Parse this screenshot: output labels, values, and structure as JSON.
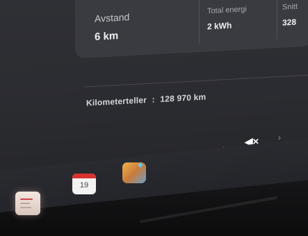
{
  "trip": {
    "distance": {
      "label": "Avstand",
      "value": "6 km"
    },
    "total_energy": {
      "label": "Total energi",
      "value": "2 kWh"
    },
    "average": {
      "label": "Snitt",
      "value": "328"
    }
  },
  "odometer": {
    "label": "Kilometerteller",
    "separator": ":",
    "value": "128 970 km"
  },
  "media": {
    "prev_icon": "chevron-left-icon",
    "mute_icon": "speaker-muted-icon",
    "next_icon": "chevron-right-icon",
    "prev_glyph": "‹",
    "mute_glyph": "◀×",
    "next_glyph": "›"
  },
  "dock": {
    "apps": [
      {
        "name": "notes",
        "icon": "notes-app-icon"
      },
      {
        "name": "calendar",
        "icon": "calendar-app-icon",
        "day": "19"
      },
      {
        "name": "toybox",
        "icon": "toybox-app-icon"
      }
    ]
  },
  "colors": {
    "screen_bg": "#2b2c31",
    "card_bg": "#3a3b40",
    "text_primary": "#f0f0f2",
    "calendar_red": "#d8322f"
  }
}
